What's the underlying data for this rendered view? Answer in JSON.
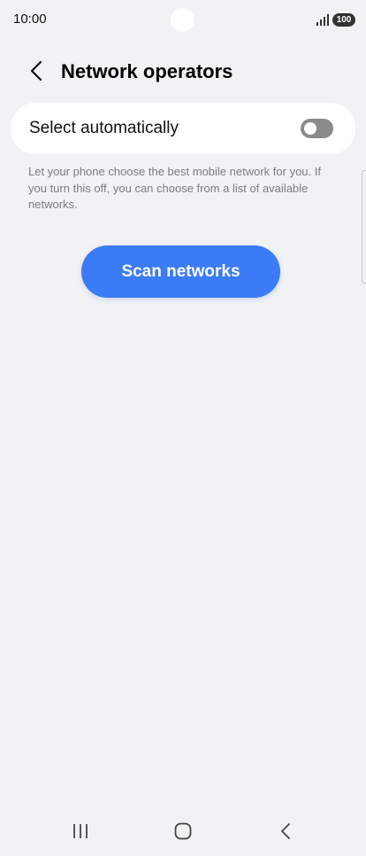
{
  "status_bar": {
    "time": "10:00",
    "battery": "100",
    "signal_icon": "signal-bars-icon"
  },
  "header": {
    "back_icon": "chevron-left-icon",
    "title": "Network operators"
  },
  "select_automatically": {
    "label": "Select automatically",
    "enabled": false
  },
  "help_text": "Let your phone choose the best mobile network for you. If you turn this off, you can choose from a list of available networks.",
  "scan_button": {
    "label": "Scan networks",
    "color": "#3b7bf6"
  },
  "nav_bar": {
    "recents_icon": "recents-icon",
    "home_icon": "home-icon",
    "back_icon": "back-icon"
  }
}
